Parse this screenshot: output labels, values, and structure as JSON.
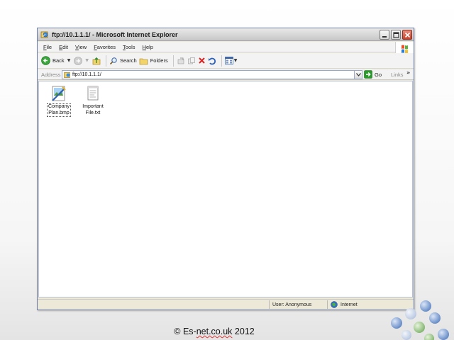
{
  "window": {
    "title": "ftp://10.1.1.1/ - Microsoft Internet Explorer"
  },
  "menu": {
    "items": [
      "File",
      "Edit",
      "View",
      "Favorites",
      "Tools",
      "Help"
    ]
  },
  "toolbar": {
    "back_label": "Back",
    "search_label": "Search",
    "folders_label": "Folders"
  },
  "address": {
    "label": "Address",
    "value": "ftp://10.1.1.1/",
    "go_label": "Go",
    "links_label": "Links"
  },
  "files": [
    {
      "name": "Company\nPlan.bmp",
      "type": "bmp",
      "selected": true
    },
    {
      "name": "Important\nFile.txt",
      "type": "txt",
      "selected": false
    }
  ],
  "status": {
    "user": "User: Anonymous",
    "zone": "Internet"
  },
  "footer": {
    "prefix": "© Es-",
    "squiggle": "net.co.uk",
    "suffix": " 2012"
  },
  "icons": {
    "title": "ie-ftp-icon",
    "back": "back-arrow-icon",
    "forward": "forward-arrow-icon",
    "up": "folder-up-icon",
    "search": "search-icon",
    "folders": "folders-icon",
    "go": "go-arrow-icon",
    "zone": "internet-globe-icon"
  },
  "colors": {
    "content_bg": "#ffffff",
    "chrome_bg": "#ece9d8",
    "go_green": "#2a9a2a",
    "close_red": "#c5412a"
  }
}
